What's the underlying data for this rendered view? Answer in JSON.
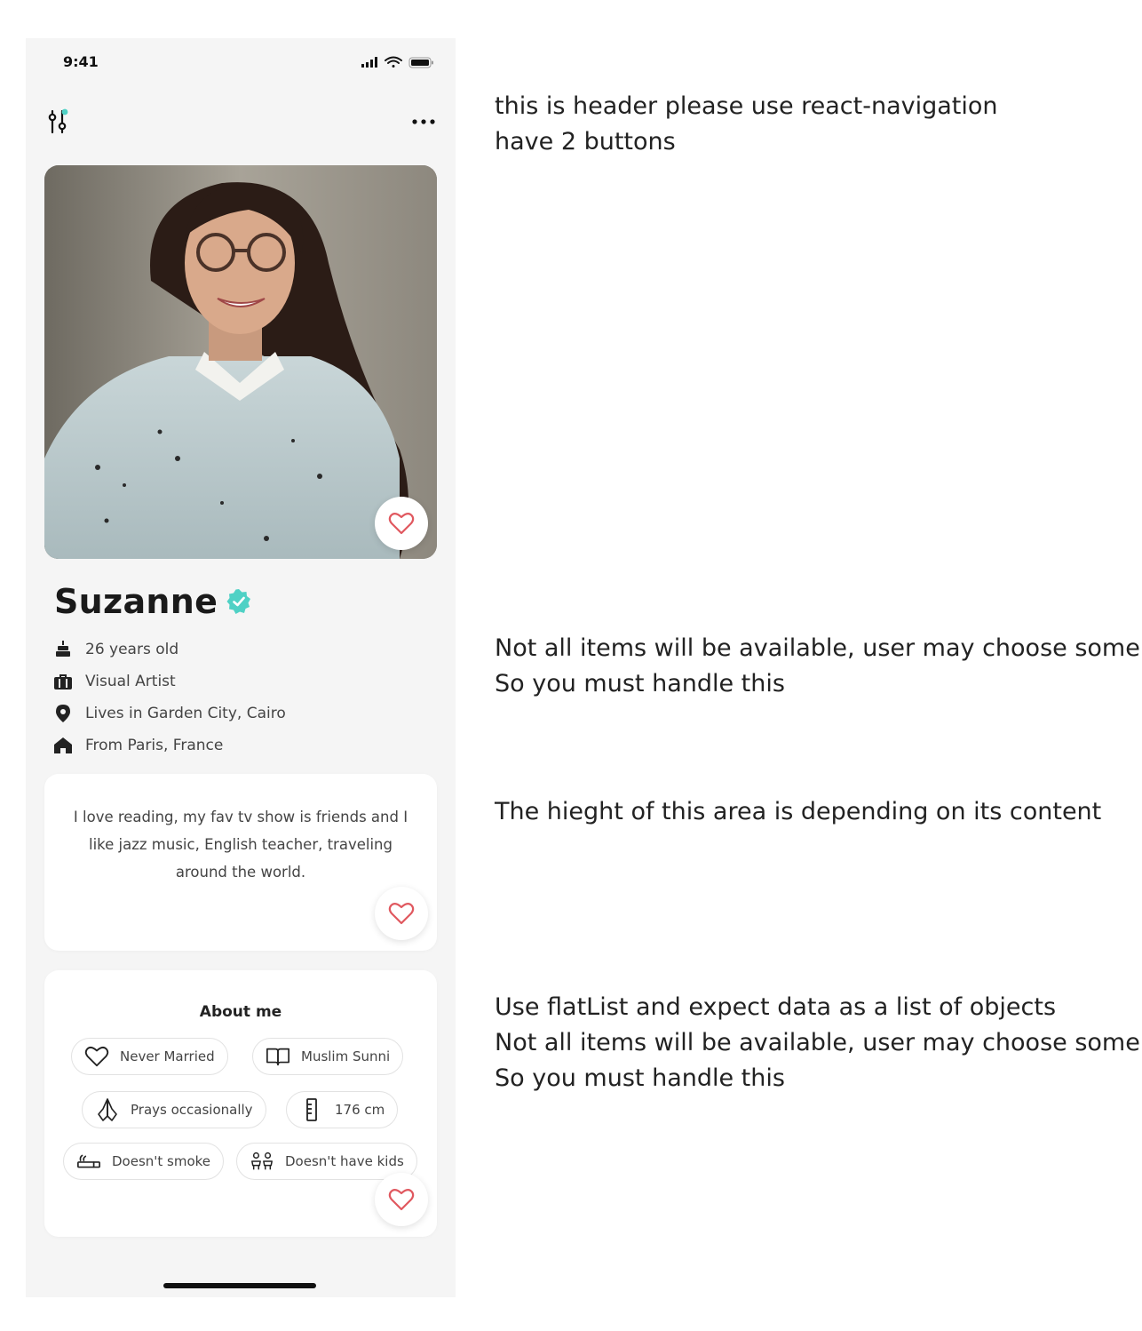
{
  "status_bar": {
    "time": "9:41"
  },
  "profile": {
    "name": "Suzanne",
    "info": [
      {
        "icon": "cake-icon",
        "text": "26 years old"
      },
      {
        "icon": "briefcase-icon",
        "text": "Visual Artist"
      },
      {
        "icon": "location-pin-icon",
        "text": "Lives in Garden City, Cairo"
      },
      {
        "icon": "home-icon",
        "text": "From Paris, France"
      }
    ],
    "bio": "I love reading, my fav tv show is friends and I like jazz music, English teacher, traveling around the world."
  },
  "about": {
    "title": "About me",
    "chips": [
      {
        "icon": "heart-outline-icon",
        "label": "Never Married"
      },
      {
        "icon": "book-icon",
        "label": "Muslim Sunni"
      },
      {
        "icon": "praying-hands-icon",
        "label": "Prays occasionally"
      },
      {
        "icon": "ruler-icon",
        "label": "176 cm"
      },
      {
        "icon": "cigarette-icon",
        "label": "Doesn't smoke"
      },
      {
        "icon": "kids-icon",
        "label": "Doesn't have kids"
      }
    ]
  },
  "notes": {
    "header": [
      "this is header please use react-navigation",
      "have 2 buttons"
    ],
    "info": [
      "Not all items will be available, user may choose some",
      "So you must handle this"
    ],
    "bio": [
      "The hieght of this area is depending on its content"
    ],
    "about": [
      "Use flatList and  expect data as a list of objects",
      "Not all items will be available, user may choose some",
      "So you must handle this"
    ]
  },
  "colors": {
    "accent_teal": "#4fd1c5",
    "like_red": "#e0585f",
    "background": "#f5f5f5"
  }
}
